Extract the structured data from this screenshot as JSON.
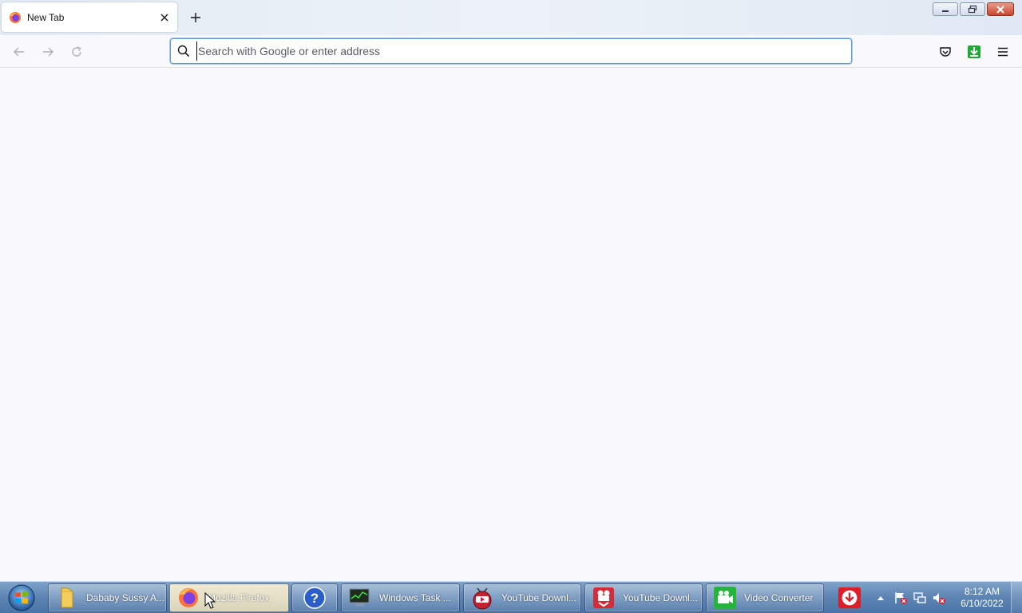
{
  "browser": {
    "tab": {
      "title": "New Tab",
      "favicon": "firefox-icon",
      "close_icon": "close-icon"
    },
    "new_tab_icon": "plus-icon",
    "window_controls": [
      "minimize-icon",
      "restore-icon",
      "close-icon"
    ],
    "nav": {
      "back_icon": "arrow-left-icon",
      "forward_icon": "arrow-right-icon",
      "reload_icon": "reload-icon"
    },
    "urlbar": {
      "value": "",
      "placeholder": "Search with Google or enter address",
      "icon": "search-icon"
    },
    "toolbar": [
      "pocket-icon",
      "download-extension-icon",
      "hamburger-menu-icon"
    ]
  },
  "taskbar": {
    "start_icon": "windows-orb-icon",
    "buttons": [
      {
        "label": "Dababy Sussy A...",
        "icon": "folder-icon"
      },
      {
        "label": "Mozilla Firefox",
        "icon": "firefox-icon",
        "active": true
      },
      {
        "label": "",
        "icon": "help-icon"
      },
      {
        "label": "Windows Task ...",
        "icon": "task-manager-icon"
      },
      {
        "label": "YouTube Downl...",
        "icon": "youtube-downloader-icon"
      },
      {
        "label": "YouTube Downl...",
        "icon": "youtube-downloader-red-icon"
      },
      {
        "label": "Video Converter",
        "icon": "video-camera-icon"
      }
    ],
    "pinned_icon": "download-arrow-icon",
    "tray_icons": [
      "show-hidden-icons-arrow",
      "action-center-flag-icon",
      "network-icon",
      "volume-muted-icon"
    ],
    "clock": {
      "time": "8:12 AM",
      "date": "6/10/2022"
    }
  },
  "colors": {
    "accent": "#5a9cd6",
    "taskbar": "#5f86b4",
    "content_bg": "#f9f9fb"
  }
}
